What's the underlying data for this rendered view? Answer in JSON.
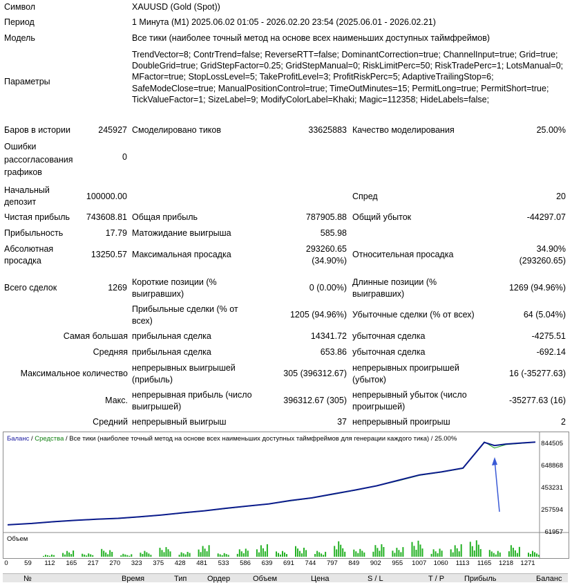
{
  "summary": {
    "symbol": {
      "label": "Символ",
      "value": "XAUUSD (Gold (Spot))"
    },
    "period": {
      "label": "Период",
      "value": "1 Минута (M1) 2025.06.02 01:05 - 2026.02.20 23:54 (2025.06.01 - 2026.02.21)"
    },
    "model": {
      "label": "Модель",
      "value": "Все тики (наиболее точный метод на основе всех наименьших доступных таймфреймов)"
    },
    "parameters": {
      "label": "Параметры",
      "value": "TrendVector=8; ContrTrend=false; ReverseRTT=false; DominantCorrection=true; ChannelInput=true; Grid=true; DoubleGrid=true; GridStepFactor=0.25; GridStepManual=0; RiskLimitPerc=50; RiskTradePerc=1; LotsManual=0; MFactor=true; StopLossLevel=5; TakeProfitLevel=3; ProfitRiskPerc=5; AdaptiveTrailingStop=6; SafeModeClose=true; ManualPositionControl=true; TimeOutMinutes=15; PermitLong=true; PermitShort=true; TickValueFactor=1; SizeLabel=9; ModifyColorLabel=Khaki; Magic=112358; HideLabels=false;"
    }
  },
  "stats": {
    "bars_label": "Баров в истории",
    "bars_value": "245927",
    "ticks_label": "Смоделировано тиков",
    "ticks_value": "33625883",
    "quality_label": "Качество моделирования",
    "quality_value": "25.00%",
    "errors_label": "Ошибки рассогласования графиков",
    "errors_value": "0",
    "deposit_label": "Начальный депозит",
    "deposit_value": "100000.00",
    "spread_label": "Спред",
    "spread_value": "20",
    "net_profit_label": "Чистая прибыль",
    "net_profit_value": "743608.81",
    "gross_profit_label": "Общая прибыль",
    "gross_profit_value": "787905.88",
    "gross_loss_label": "Общий убыток",
    "gross_loss_value": "-44297.07",
    "profit_factor_label": "Прибыльность",
    "profit_factor_value": "17.79",
    "expected_payoff_label": "Матожидание выигрыша",
    "expected_payoff_value": "585.98",
    "abs_dd_label": "Абсолютная просадка",
    "abs_dd_value": "13250.57",
    "max_dd_label": "Максимальная просадка",
    "max_dd_value_1": "293260.65",
    "max_dd_value_2": "(34.90%)",
    "rel_dd_label": "Относительная просадка",
    "rel_dd_value_1": "34.90%",
    "rel_dd_value_2": "(293260.65)",
    "total_trades_label": "Всего сделок",
    "total_trades_value": "1269",
    "short_label": "Короткие позиции (% выигравших)",
    "short_value": "0 (0.00%)",
    "long_label": "Длинные позиции (% выигравших)",
    "long_value": "1269 (94.96%)",
    "win_trades_label": "Прибыльные сделки (% от всех)",
    "win_trades_value": "1205 (94.96%)",
    "loss_trades_label": "Убыточные сделки (% от всех)",
    "loss_trades_value": "64 (5.04%)",
    "largest_label": "Самая большая",
    "largest_win_label": "прибыльная сделка",
    "largest_win_value": "14341.72",
    "largest_loss_label": "убыточная сделка",
    "largest_loss_value": "-4275.51",
    "average_label": "Средняя",
    "average_win_label": "прибыльная сделка",
    "average_win_value": "653.86",
    "average_loss_label": "убыточная сделка",
    "average_loss_value": "-692.14",
    "max_count_label": "Максимальное количество",
    "max_cons_wins_label": "непрерывных выигрышей (прибыль)",
    "max_cons_wins_value": "305 (396312.67)",
    "max_cons_losses_label": "непрерывных проигрышей (убыток)",
    "max_cons_losses_value": "16 (-35277.63)",
    "max_label": "Макс.",
    "max_cons_profit_label": "непрерывная прибыль (число выигрышей)",
    "max_cons_profit_value": "396312.67 (305)",
    "max_cons_loss_label": "непрерывный убыток (число проигрышей)",
    "max_cons_loss_value": "-35277.63 (16)",
    "avg_label": "Средний",
    "avg_cons_wins_label": "непрерывный выигрыш",
    "avg_cons_wins_value": "37",
    "avg_cons_losses_label": "непрерывный проигрыш",
    "avg_cons_losses_value": "2"
  },
  "chart": {
    "legend_balance": "Баланс",
    "legend_sep1": " / ",
    "legend_equity": "Средства",
    "legend_rest": " / Все тики (наиболее точный метод на основе всех наименьших доступных таймфреймов для генерации каждого тика) / 25.00%",
    "volume_label": "Объем",
    "y_ticks": [
      "844505",
      "648868",
      "453231",
      "257594",
      "61957"
    ],
    "x_ticks": [
      "0",
      "59",
      "112",
      "165",
      "217",
      "270",
      "323",
      "375",
      "428",
      "481",
      "533",
      "586",
      "639",
      "691",
      "744",
      "797",
      "849",
      "902",
      "955",
      "1007",
      "1060",
      "1113",
      "1165",
      "1218",
      "1271"
    ]
  },
  "colors": {
    "balance": "#0a1a8c",
    "equity": "#1aa01a",
    "volume": "#22b022",
    "arrow": "#3a5ad6",
    "text_blue": "#1a1aa0",
    "text_green": "#108010"
  },
  "chart_data": {
    "type": "line",
    "x": [
      0,
      59,
      112,
      165,
      217,
      270,
      323,
      375,
      428,
      481,
      533,
      586,
      639,
      691,
      744,
      797,
      849,
      902,
      955,
      1007,
      1060,
      1113,
      1165,
      1190,
      1218,
      1271,
      1290
    ],
    "series": [
      {
        "name": "Баланс",
        "values": [
          100000,
          112000,
          128000,
          140000,
          150000,
          158000,
          172000,
          188000,
          208000,
          226000,
          248000,
          268000,
          288000,
          318000,
          342000,
          378000,
          412000,
          450000,
          500000,
          548000,
          575000,
          610000,
          840000,
          812000,
          825000,
          838000,
          843000
        ]
      },
      {
        "name": "Средства",
        "values": [
          100000,
          111000,
          126000,
          139000,
          149000,
          156000,
          170000,
          186000,
          205000,
          224000,
          245000,
          266000,
          286000,
          314000,
          340000,
          374000,
          409000,
          448000,
          495000,
          544000,
          572000,
          606000,
          845000,
          790000,
          820000,
          835000,
          842000
        ]
      }
    ],
    "ylim": [
      61957,
      844505
    ],
    "volume": [
      0.12,
      0.35,
      0.2,
      0.4,
      0.15,
      0.3,
      0.5,
      0.25,
      0.6,
      0.2,
      0.45,
      0.7,
      0.35,
      0.55,
      0.3,
      0.8,
      0.4,
      0.65,
      0.5,
      0.9,
      0.45,
      0.7,
      1.0,
      0.35,
      0.6,
      0.3
    ]
  },
  "table_header": {
    "num": "№",
    "time": "Время",
    "type": "Тип",
    "order": "Ордер",
    "volume": "Объем",
    "price": "Цена",
    "sl": "S / L",
    "tp": "T / P",
    "profit": "Прибыль",
    "balance": "Баланс"
  }
}
